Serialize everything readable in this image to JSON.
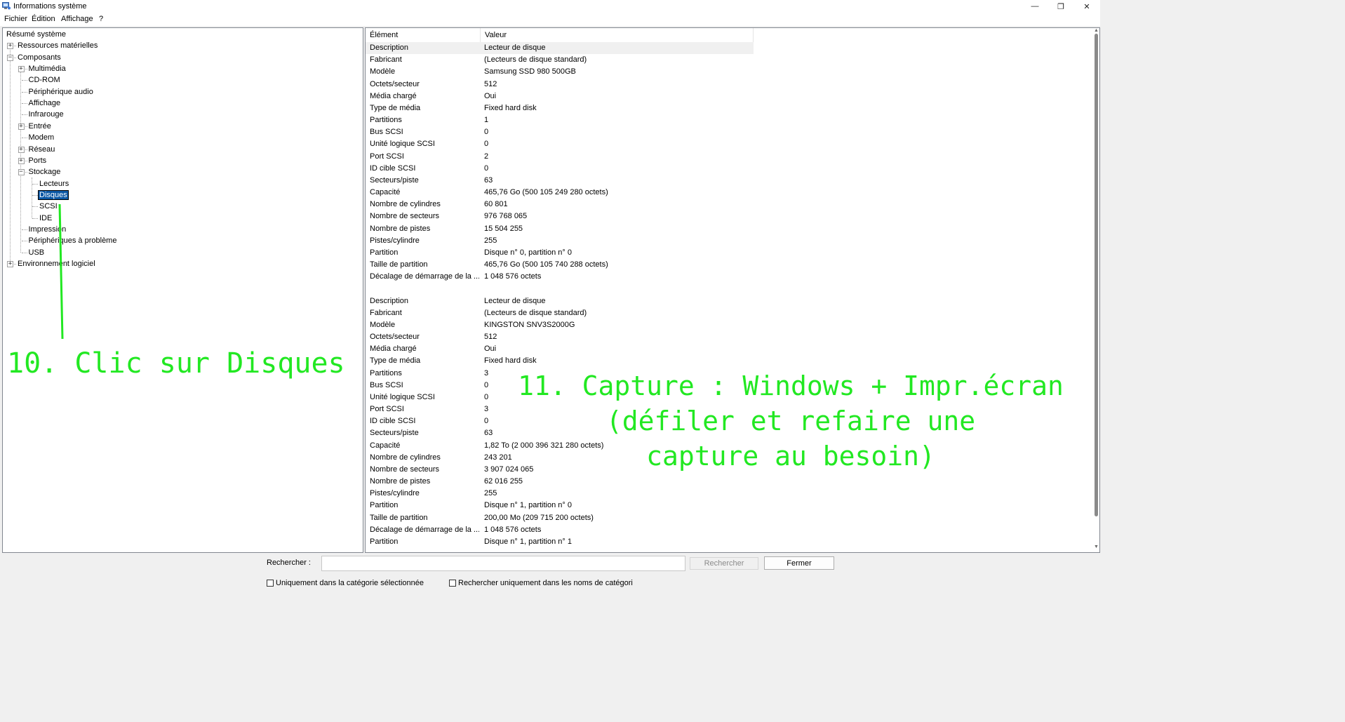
{
  "window": {
    "title": "Informations système",
    "min_glyph": "—",
    "max_glyph": "❐",
    "close_glyph": "✕",
    "icon": "system-info-icon"
  },
  "menu": [
    "Fichier",
    "Édition",
    "Affichage",
    "?"
  ],
  "tree": {
    "items": [
      {
        "label": "Résumé système",
        "level": 0,
        "expander": ""
      },
      {
        "label": "Ressources matérielles",
        "level": 1,
        "expander": "+"
      },
      {
        "label": "Composants",
        "level": 1,
        "expander": "-"
      },
      {
        "label": "Multimédia",
        "level": 2,
        "expander": "+"
      },
      {
        "label": "CD-ROM",
        "level": 2,
        "expander": ""
      },
      {
        "label": "Périphérique audio",
        "level": 2,
        "expander": ""
      },
      {
        "label": "Affichage",
        "level": 2,
        "expander": ""
      },
      {
        "label": "Infrarouge",
        "level": 2,
        "expander": ""
      },
      {
        "label": "Entrée",
        "level": 2,
        "expander": "+"
      },
      {
        "label": "Modem",
        "level": 2,
        "expander": ""
      },
      {
        "label": "Réseau",
        "level": 2,
        "expander": "+"
      },
      {
        "label": "Ports",
        "level": 2,
        "expander": "+"
      },
      {
        "label": "Stockage",
        "level": 2,
        "expander": "-"
      },
      {
        "label": "Lecteurs",
        "level": 3,
        "expander": ""
      },
      {
        "label": "Disques",
        "level": 3,
        "expander": "",
        "selected": true
      },
      {
        "label": "SCSI",
        "level": 3,
        "expander": ""
      },
      {
        "label": "IDE",
        "level": 3,
        "expander": ""
      },
      {
        "label": "Impression",
        "level": 2,
        "expander": ""
      },
      {
        "label": "Périphériques à problème",
        "level": 2,
        "expander": ""
      },
      {
        "label": "USB",
        "level": 2,
        "expander": ""
      },
      {
        "label": "Environnement logiciel",
        "level": 1,
        "expander": "+"
      }
    ]
  },
  "details": {
    "columns": [
      "Élément",
      "Valeur"
    ],
    "rows": [
      [
        "Description",
        "Lecteur de disque"
      ],
      [
        "Fabricant",
        "(Lecteurs de disque standard)"
      ],
      [
        "Modèle",
        "Samsung SSD 980 500GB"
      ],
      [
        "Octets/secteur",
        "512"
      ],
      [
        "Média chargé",
        "Oui"
      ],
      [
        "Type de média",
        "Fixed hard disk"
      ],
      [
        "Partitions",
        "1"
      ],
      [
        "Bus SCSI",
        "0"
      ],
      [
        "Unité logique SCSI",
        "0"
      ],
      [
        "Port SCSI",
        "2"
      ],
      [
        "ID cible SCSI",
        "0"
      ],
      [
        "Secteurs/piste",
        "63"
      ],
      [
        "Capacité",
        "465,76 Go (500 105 249 280 octets)"
      ],
      [
        "Nombre de cylindres",
        "60 801"
      ],
      [
        "Nombre de secteurs",
        "976 768 065"
      ],
      [
        "Nombre de pistes",
        "15 504 255"
      ],
      [
        "Pistes/cylindre",
        "255"
      ],
      [
        "Partition",
        "Disque n° 0, partition n° 0"
      ],
      [
        "Taille de partition",
        "465,76 Go (500 105 740 288 octets)"
      ],
      [
        "Décalage de démarrage de la ...",
        "1 048 576 octets"
      ],
      [
        "",
        ""
      ],
      [
        "Description",
        "Lecteur de disque"
      ],
      [
        "Fabricant",
        "(Lecteurs de disque standard)"
      ],
      [
        "Modèle",
        "KINGSTON SNV3S2000G"
      ],
      [
        "Octets/secteur",
        "512"
      ],
      [
        "Média chargé",
        "Oui"
      ],
      [
        "Type de média",
        "Fixed hard disk"
      ],
      [
        "Partitions",
        "3"
      ],
      [
        "Bus SCSI",
        "0"
      ],
      [
        "Unité logique SCSI",
        "0"
      ],
      [
        "Port SCSI",
        "3"
      ],
      [
        "ID cible SCSI",
        "0"
      ],
      [
        "Secteurs/piste",
        "63"
      ],
      [
        "Capacité",
        "1,82 To (2 000 396 321 280 octets)"
      ],
      [
        "Nombre de cylindres",
        "243 201"
      ],
      [
        "Nombre de secteurs",
        "3 907 024 065"
      ],
      [
        "Nombre de pistes",
        "62 016 255"
      ],
      [
        "Pistes/cylindre",
        "255"
      ],
      [
        "Partition",
        "Disque n° 1, partition n° 0"
      ],
      [
        "Taille de partition",
        "200,00 Mo (209 715 200 octets)"
      ],
      [
        "Décalage de démarrage de la ...",
        "1 048 576 octets"
      ],
      [
        "Partition",
        "Disque n° 1, partition n° 1"
      ]
    ]
  },
  "search": {
    "label": "Rechercher :",
    "value": "",
    "search_button": "Rechercher",
    "close_button": "Fermer",
    "option1": "Uniquement dans la catégorie sélectionnée",
    "option2": "Rechercher uniquement dans les noms de catégori"
  },
  "annotations": {
    "step10": "10. Clic sur Disques",
    "step11_line1": "11. Capture : Windows + Impr.écran",
    "step11_line2": "(défiler et refaire une",
    "step11_line3": "capture au besoin)",
    "color": "#22e822"
  }
}
